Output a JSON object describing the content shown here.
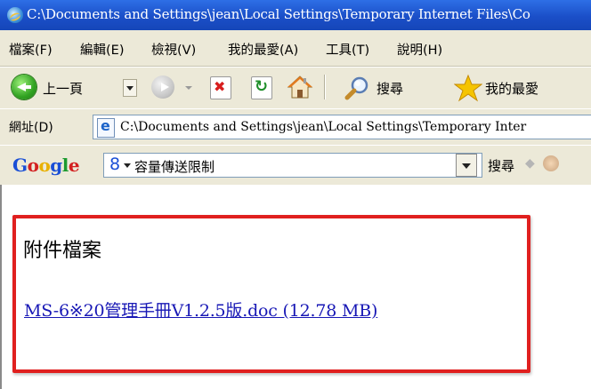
{
  "window": {
    "title": "C:\\Documents and Settings\\jean\\Local Settings\\Temporary Internet Files\\Co"
  },
  "menubar": {
    "items": [
      "檔案(F)",
      "編輯(E)",
      "檢視(V)",
      "我的最愛(A)",
      "工具(T)",
      "說明(H)"
    ]
  },
  "toolbar": {
    "back_label": "上一頁",
    "search_label": "搜尋",
    "favorites_label": "我的最愛"
  },
  "addressbar": {
    "label": "網址(D)",
    "url": "C:\\Documents and Settings\\jean\\Local Settings\\Temporary Inter"
  },
  "googlebar": {
    "logo": [
      "G",
      "o",
      "o",
      "g",
      "l",
      "e"
    ],
    "search_value": "容量傳送限制",
    "search_button": "搜尋"
  },
  "content": {
    "heading": "附件檔案",
    "attachment_link": "MS-6※20管理手冊V1.2.5版.doc (12.78 MB)"
  },
  "colors": {
    "titlebar": "#1b4fc8",
    "chrome": "#ece9d8",
    "link": "#1717b5",
    "highlight": "#e0201f"
  }
}
